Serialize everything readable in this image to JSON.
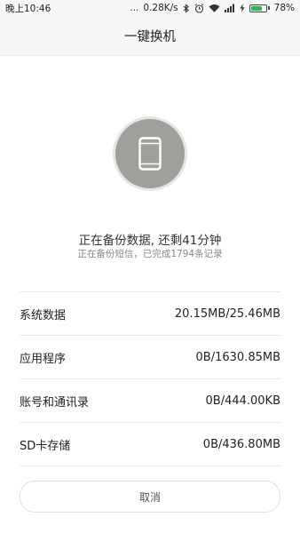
{
  "statusbar": {
    "time": "晚上10:46",
    "dots": "...",
    "speed": "0.28K/s",
    "battery_percent": "78%",
    "battery_level": 0.78,
    "icons": [
      "bluetooth-icon",
      "alarm-icon",
      "wifi-icon",
      "signal-icon",
      "charging-icon",
      "battery-icon"
    ]
  },
  "header": {
    "title": "一键换机"
  },
  "progress": {
    "icon": "phone-icon",
    "main_text": "正在备份数据, 还剩41分钟",
    "sub_text": "正在备份短信，已完成1794条记录"
  },
  "items": [
    {
      "label": "系统数据",
      "value": "20.15MB/25.46MB"
    },
    {
      "label": "应用程序",
      "value": "0B/1630.85MB"
    },
    {
      "label": "账号和通讯录",
      "value": "0B/444.00KB"
    },
    {
      "label": "SD卡存储",
      "value": "0B/436.80MB"
    }
  ],
  "footer": {
    "cancel_label": "取消"
  },
  "colors": {
    "background": "#f7f7f7",
    "circle": "#a19f9c",
    "battery": "#2db84c"
  }
}
